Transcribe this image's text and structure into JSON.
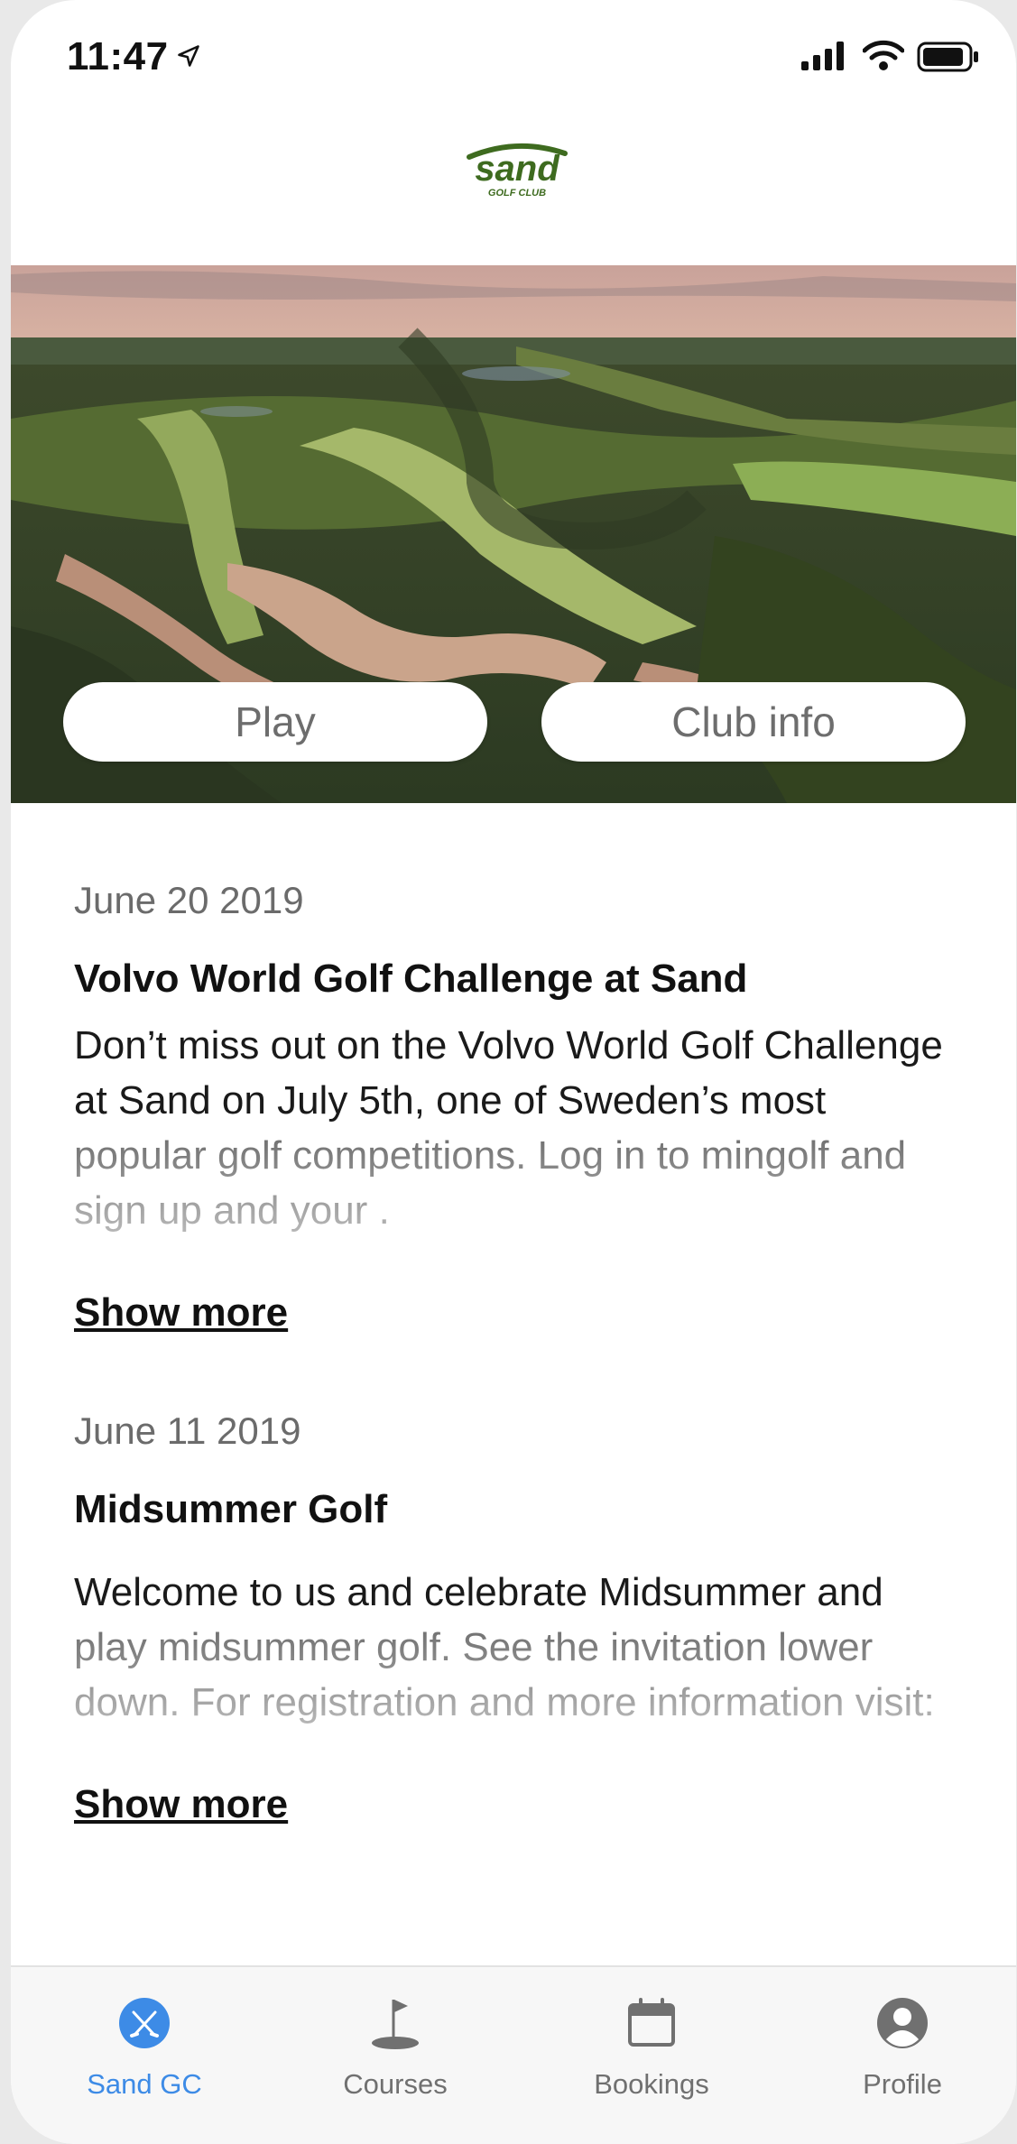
{
  "status_bar": {
    "time": "11:47"
  },
  "brand": {
    "logo_text": "sand",
    "logo_subtext": "GOLF CLUB"
  },
  "hero": {
    "buttons": {
      "play": "Play",
      "club_info": "Club info"
    }
  },
  "news": [
    {
      "date": "June 20 2019",
      "title": "Volvo World Golf Challenge at Sand",
      "body": "Don’t miss out on the Volvo World Golf Challenge at Sand on July 5th, one of Sweden’s most popular golf competitions. Log in to mingolf and sign up and your .",
      "more": "Show more"
    },
    {
      "date": "June 11 2019",
      "title": "Midsummer Golf",
      "body": "Welcome to us and celebrate Midsummer and play midsummer golf. See the invitation lower down. For registration and more information visit:",
      "more": "Show more"
    }
  ],
  "tabbar": {
    "items": [
      {
        "label": "Sand GC",
        "icon": "golf-clubs-icon",
        "active": true
      },
      {
        "label": "Courses",
        "icon": "flag-icon"
      },
      {
        "label": "Bookings",
        "icon": "calendar-icon"
      },
      {
        "label": "Profile",
        "icon": "person-icon"
      }
    ]
  },
  "colors": {
    "accent": "#3d8be6",
    "logo_green": "#3e6b1f"
  }
}
